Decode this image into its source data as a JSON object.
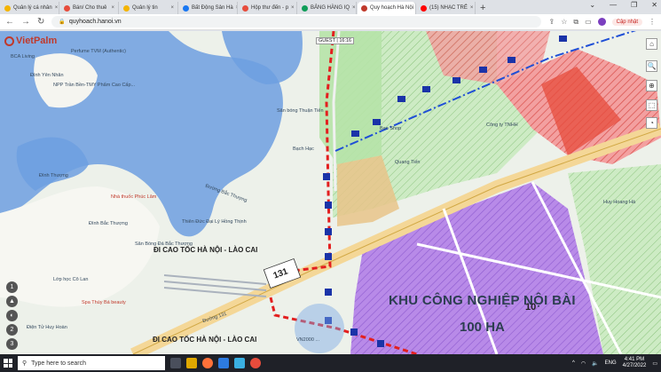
{
  "tabs": [
    {
      "label": "Quản lý cá nhân",
      "close": "×",
      "color": "#f4b400"
    },
    {
      "label": "Bán/ Cho thuê",
      "close": "×",
      "color": "#e74c3c"
    },
    {
      "label": "Quản lý tin",
      "close": "×",
      "color": "#f4b400"
    },
    {
      "label": "Bất Động Sản Hà",
      "close": "×",
      "color": "#1877f2"
    },
    {
      "label": "Hộp thư đến - p",
      "close": "×",
      "color": "#e74c3c"
    },
    {
      "label": "BẢNG HÀNG IQ",
      "close": "×",
      "color": "#0f9d58"
    },
    {
      "label": "Quy hoạch Hà Nội",
      "close": "×",
      "color": "#c0392b",
      "active": true
    },
    {
      "label": "(15) NHẠC TRẺ",
      "close": "×",
      "color": "#ff0000"
    }
  ],
  "newtab": "+",
  "window_controls": [
    "⌄",
    "—",
    "❐",
    "✕"
  ],
  "nav": {
    "back": "←",
    "forward": "→",
    "reload": "↻"
  },
  "url": "quyhoach.hanoi.vn",
  "update_label": "Cập nhật",
  "map": {
    "logo": "VietPalm",
    "guest": "GUEST | 16:16",
    "labels": [
      "BCA Living",
      "Perfume TVM (Authentic)",
      "Đình Yên Nhân",
      "NPP Trần Bền-TMY Phẩm Cao Cấp...",
      "Nhà thuốc Phúc Lâm",
      "Đình Bắc Thượng",
      "Thiên Đức Đại Lý Hồng Thịnh",
      "Sân Bóng Đá Bắc Thượng",
      "Lớp học Cô Lan",
      "Spa Thúy Bá beauty",
      "Điện Tử Huy Hoàn",
      "Sân bóng Thuận Tiến",
      "Bạch Hạc",
      "Bao Shop",
      "Công ty TNHH",
      "Quang Tiến",
      "Đình Thượng",
      "Đường Bắc Thượng",
      "Đường 131",
      "Huy Hoang Hà",
      "VN2000 ..."
    ],
    "road1": "ĐI CAO TỐC HÀ NỘI - LÀO CAI",
    "road2": "ĐI CAO TỐC HÀ NỘI - LÀO CAI",
    "road_number": "131",
    "zone_title": "KHU CÔNG NGHIỆP NỘI BÀI",
    "zone_area": "100 HA",
    "zone_number": "10",
    "tools_right": [
      "⌂",
      "🔍",
      "⊕",
      "⬚",
      "◔"
    ],
    "tools_left": [
      "1",
      "▲",
      "◐",
      "2",
      "3",
      "+",
      "−"
    ]
  },
  "taskbar": {
    "search_placeholder": "Type here to search",
    "lang": "ENG",
    "time": "4:41 PM",
    "date": "4/27/2022"
  },
  "colors": {
    "accent": "#c0392b",
    "zone": "#a56ae0",
    "green": "#c9efc0",
    "water": "#6b9fe0"
  }
}
